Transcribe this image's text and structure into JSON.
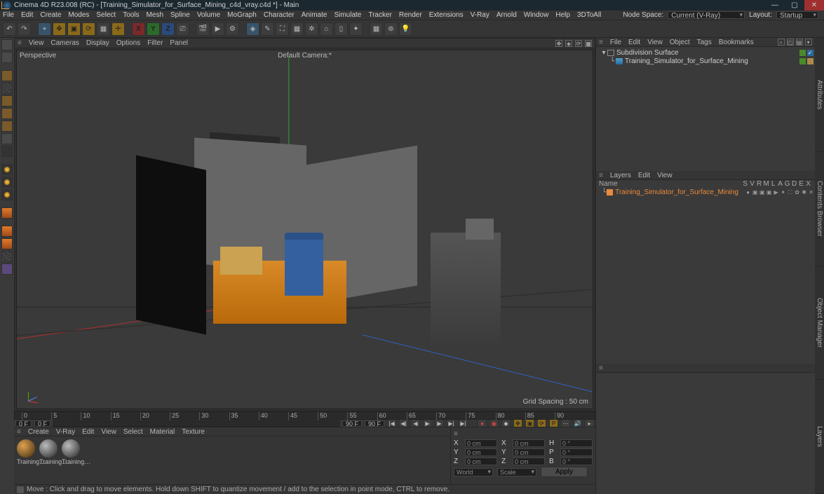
{
  "title": "Cinema 4D R23.008 (RC) - [Training_Simulator_for_Surface_Mining_c4d_vray.c4d *] - Main",
  "menubar": [
    "File",
    "Edit",
    "Create",
    "Modes",
    "Select",
    "Tools",
    "Mesh",
    "Spline",
    "Volume",
    "MoGraph",
    "Character",
    "Animate",
    "Simulate",
    "Tracker",
    "Render",
    "Extensions",
    "V-Ray",
    "Arnold",
    "Window",
    "Help",
    "3DToAll"
  ],
  "nodespace_label": "Node Space:",
  "nodespace_value": "Current (V-Ray)",
  "layout_label": "Layout:",
  "layout_value": "Startup",
  "axis_labels": {
    "x": "X",
    "y": "Y",
    "z": "Z"
  },
  "vp_menu": [
    "View",
    "Cameras",
    "Display",
    "Options",
    "Filter",
    "Panel"
  ],
  "persp": "Perspective",
  "camera": "Default Camera:*",
  "grid_spacing": "Grid Spacing : 50 cm",
  "t_start": "0 F",
  "t_end": "90 F",
  "t_end2": "90 F",
  "t_start2": "0 F",
  "ruler_max": 90,
  "mat_menu": [
    "Create",
    "V-Ray",
    "Edit",
    "View",
    "Select",
    "Material",
    "Texture"
  ],
  "mat_chips": [
    "Training…",
    "Training…",
    "Training…"
  ],
  "coords": {
    "x": {
      "p": "0 cm",
      "s": "0 cm",
      "r": "0 °"
    },
    "y": {
      "p": "0 cm",
      "s": "0 cm",
      "r": "0 °"
    },
    "z": {
      "p": "0 cm",
      "s": "0 cm",
      "r": "0 °"
    }
  },
  "coord_labels": {
    "X": "X",
    "Y": "Y",
    "Z": "Z",
    "sx": "X",
    "sy": "Y",
    "sz": "Z",
    "H": "H",
    "P": "P",
    "B": "B"
  },
  "coord_space": "World",
  "coord_mode": "Scale",
  "apply": "Apply",
  "status": "Move : Click and drag to move elements. Hold down SHIFT to quantize movement / add to the selection in point mode, CTRL to remove.",
  "obj_menu": [
    "File",
    "Edit",
    "View",
    "Object",
    "Tags",
    "Bookmarks"
  ],
  "tree": [
    {
      "indent": 0,
      "type": "null",
      "name": "Subdivision Surface",
      "chips": [
        "green",
        "check"
      ]
    },
    {
      "indent": 1,
      "type": "cube",
      "name": "Training_Simulator_for_Surface_Mining",
      "chips": [
        "green",
        "tan"
      ]
    }
  ],
  "layer_menu": [
    "Layers",
    "Edit",
    "View"
  ],
  "layer_head": [
    "Name",
    "S",
    "V",
    "R",
    "M",
    "L",
    "A",
    "G",
    "D",
    "E",
    "X"
  ],
  "layer_item": "Training_Simulator_for_Surface_Mining",
  "vtabs": [
    "Attributes",
    "Contents Browser",
    "Object Manager",
    "Layers"
  ]
}
